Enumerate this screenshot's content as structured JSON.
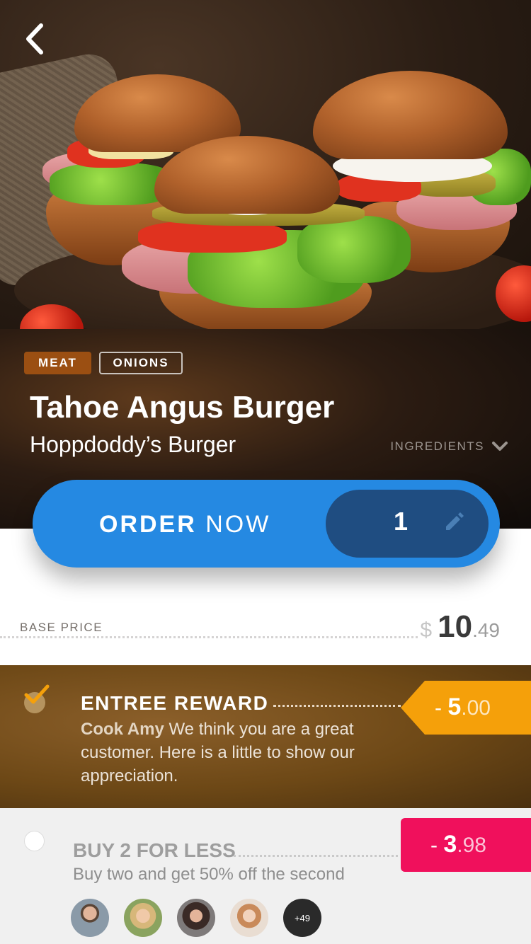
{
  "tags": [
    "MEAT",
    "ONIONS"
  ],
  "product": {
    "title": "Tahoe Angus Burger",
    "restaurant": "Hoppdoddy’s Burger",
    "ingredients_label": "INGREDIENTS"
  },
  "order": {
    "label_bold": "ORDER",
    "label_rest": "NOW",
    "quantity": "1"
  },
  "base_price": {
    "label": "BASE PRICE",
    "currency": "$",
    "whole": "10",
    "cents": ".49"
  },
  "reward": {
    "checked": true,
    "title": "ENTREE REWARD",
    "author": "Cook Amy",
    "description": " We think you are a great customer. Here is a little to show our appreciation.",
    "price_sign": "-",
    "price_whole": "5",
    "price_cents": ".00",
    "color": "#f5a00a"
  },
  "buy2": {
    "checked": false,
    "title": "BUY 2 FOR LESS",
    "description": "Buy two and get 50% off the second",
    "price_sign": "-",
    "price_whole": "3",
    "price_cents": ".98",
    "color": "#f0105c",
    "more_count": "+49"
  },
  "colors": {
    "primary": "#2589e2",
    "primary_dark": "#1f4d81",
    "tag_meat": "#9b4f12"
  },
  "icons": [
    "back-chevron-icon",
    "chevron-down-icon",
    "pencil-icon",
    "checkmark-icon",
    "radio-icon"
  ]
}
